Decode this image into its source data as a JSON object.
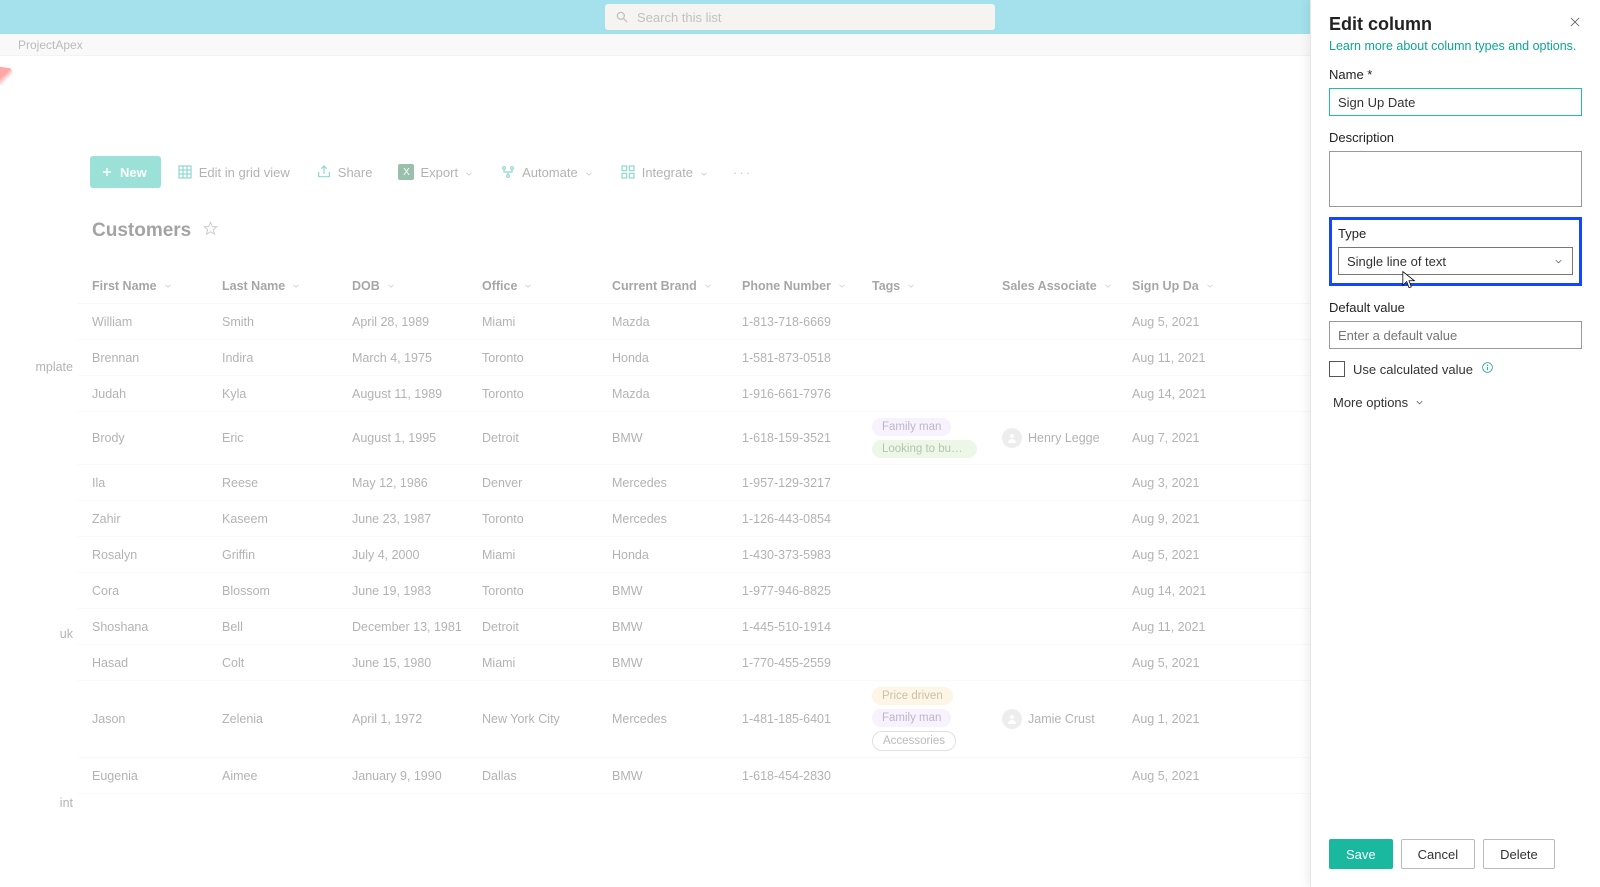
{
  "topbar": {
    "search_placeholder": "Search this list"
  },
  "breadcrumb": "ProjectApex",
  "left_fragments": {
    "template_label": "mplate",
    "uk_label": "uk",
    "int_label": "int"
  },
  "commands": {
    "new": "New",
    "edit_grid": "Edit in grid view",
    "share": "Share",
    "export": "Export",
    "automate": "Automate",
    "integrate": "Integrate"
  },
  "list": {
    "title": "Customers",
    "columns": [
      "First Name",
      "Last Name",
      "DOB",
      "Office",
      "Current Brand",
      "Phone Number",
      "Tags",
      "Sales Associate",
      "Sign Up Da"
    ],
    "rows": [
      {
        "first": "William",
        "last": "Smith",
        "dob": "April 28, 1989",
        "office": "Miami",
        "brand": "Mazda",
        "phone": "1-813-718-6669",
        "tags": [],
        "assoc": "",
        "signup": "Aug 5, 2021"
      },
      {
        "first": "Brennan",
        "last": "Indira",
        "dob": "March 4, 1975",
        "office": "Toronto",
        "brand": "Honda",
        "phone": "1-581-873-0518",
        "tags": [],
        "assoc": "",
        "signup": "Aug 11, 2021"
      },
      {
        "first": "Judah",
        "last": "Kyla",
        "dob": "August 11, 1989",
        "office": "Toronto",
        "brand": "Mazda",
        "phone": "1-916-661-7976",
        "tags": [],
        "assoc": "",
        "signup": "Aug 14, 2021"
      },
      {
        "first": "Brody",
        "last": "Eric",
        "dob": "August 1, 1995",
        "office": "Detroit",
        "brand": "BMW",
        "phone": "1-618-159-3521",
        "tags": [
          {
            "t": "Family man",
            "k": "family"
          },
          {
            "t": "Looking to buy s…",
            "k": "looking"
          }
        ],
        "assoc": "Henry Legge",
        "signup": "Aug 7, 2021"
      },
      {
        "first": "Ila",
        "last": "Reese",
        "dob": "May 12, 1986",
        "office": "Denver",
        "brand": "Mercedes",
        "phone": "1-957-129-3217",
        "tags": [],
        "assoc": "",
        "signup": "Aug 3, 2021"
      },
      {
        "first": "Zahir",
        "last": "Kaseem",
        "dob": "June 23, 1987",
        "office": "Toronto",
        "brand": "Mercedes",
        "phone": "1-126-443-0854",
        "tags": [],
        "assoc": "",
        "signup": "Aug 9, 2021"
      },
      {
        "first": "Rosalyn",
        "last": "Griffin",
        "dob": "July 4, 2000",
        "office": "Miami",
        "brand": "Honda",
        "phone": "1-430-373-5983",
        "tags": [],
        "assoc": "",
        "signup": "Aug 5, 2021"
      },
      {
        "first": "Cora",
        "last": "Blossom",
        "dob": "June 19, 1983",
        "office": "Toronto",
        "brand": "BMW",
        "phone": "1-977-946-8825",
        "tags": [],
        "assoc": "",
        "signup": "Aug 14, 2021"
      },
      {
        "first": "Shoshana",
        "last": "Bell",
        "dob": "December 13, 1981",
        "office": "Detroit",
        "brand": "BMW",
        "phone": "1-445-510-1914",
        "tags": [],
        "assoc": "",
        "signup": "Aug 11, 2021"
      },
      {
        "first": "Hasad",
        "last": "Colt",
        "dob": "June 15, 1980",
        "office": "Miami",
        "brand": "BMW",
        "phone": "1-770-455-2559",
        "tags": [],
        "assoc": "",
        "signup": "Aug 5, 2021"
      },
      {
        "first": "Jason",
        "last": "Zelenia",
        "dob": "April 1, 1972",
        "office": "New York City",
        "brand": "Mercedes",
        "phone": "1-481-185-6401",
        "tags": [
          {
            "t": "Price driven",
            "k": "price"
          },
          {
            "t": "Family man",
            "k": "family"
          },
          {
            "t": "Accessories",
            "k": "acc"
          }
        ],
        "assoc": "Jamie Crust",
        "signup": "Aug 1, 2021"
      },
      {
        "first": "Eugenia",
        "last": "Aimee",
        "dob": "January 9, 1990",
        "office": "Dallas",
        "brand": "BMW",
        "phone": "1-618-454-2830",
        "tags": [],
        "assoc": "",
        "signup": "Aug 5, 2021"
      }
    ]
  },
  "panel": {
    "title": "Edit column",
    "learn_more": "Learn more about column types and options.",
    "name_label": "Name",
    "name_value": "Sign Up Date",
    "desc_label": "Description",
    "desc_value": "",
    "type_label": "Type",
    "type_value": "Single line of text",
    "default_label": "Default value",
    "default_placeholder": "Enter a default value",
    "calc_label": "Use calculated value",
    "more_options": "More options",
    "save": "Save",
    "cancel": "Cancel",
    "delete": "Delete"
  }
}
